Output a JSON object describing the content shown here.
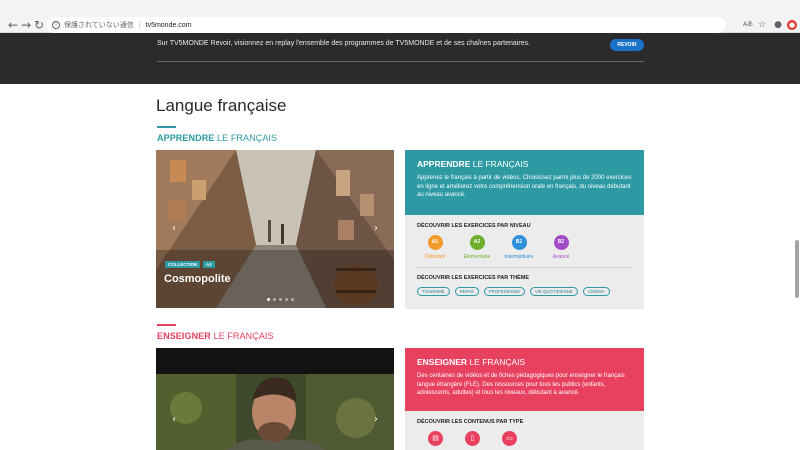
{
  "browser": {
    "back": "←",
    "forward": "→",
    "reload": "↻",
    "security_text": "保護されていない通信",
    "url": "tv5monde.com",
    "translate_icon": "Aあ",
    "star_icon": "☆",
    "profile_icon": "●",
    "extension_icon": "●"
  },
  "banner": {
    "text": "Sur TV5MONDE Revoir, visionnez en replay l'ensemble des programmes de TV5MONDE et de ses chaînes partenaires.",
    "button_label": "REVOIR"
  },
  "page": {
    "title": "Langue française"
  },
  "apprendre": {
    "label_bold": "APPRENDRE",
    "label_rest": " LE FRANÇAIS",
    "accent": "#2d9aa3",
    "carousel": {
      "tag_collection": "COLLECTION",
      "tag_level": "A2",
      "title": "Cosmopolite",
      "prev": "‹",
      "next": "›"
    },
    "panel": {
      "title_bold": "APPRENDRE",
      "title_rest": " LE FRANÇAIS",
      "text": "Apprenez le français à partir de vidéos. Choisissez parmi plus de 2000 exercices en ligne et améliorez votre compréhension orale en français, du niveau débutant au niveau avancé.",
      "levels_heading": "DÉCOUVRIR LES EXERCICES PAR NIVEAU",
      "levels": [
        {
          "code": "A1",
          "label": "Débutant",
          "color": "#f39a2b"
        },
        {
          "code": "A2",
          "label": "Élémentaire",
          "color": "#6fae2d"
        },
        {
          "code": "B1",
          "label": "Intermédiaire",
          "color": "#2f8fd8"
        },
        {
          "code": "B2",
          "label": "Avancé",
          "color": "#a44bc8"
        }
      ],
      "themes_heading": "DÉCOUVRIR LES EXERCICES PAR THÈME",
      "themes": [
        "TOURISME",
        "REPAS",
        "PROFESSIONS",
        "VIE QUOTIDIENNE",
        "CINÉMA"
      ]
    }
  },
  "enseigner": {
    "label_bold": "ENSEIGNER",
    "label_rest": " LE FRANÇAIS",
    "accent": "#e8405f",
    "carousel": {
      "prev": "‹",
      "next": "›"
    },
    "panel": {
      "title_bold": "ENSEIGNER",
      "title_rest": " LE FRANÇAIS",
      "text": "Des centaines de vidéos et de fiches pédagogiques pour enseigner le français langue étrangère (FLE). Des ressources pour tous les publics (enfants, adolescents, adultes) et tous les niveaux, débutant à avancé.",
      "types_heading": "DÉCOUVRIR LES CONTENUS PAR TYPE",
      "types": [
        {
          "icon": "document-icon",
          "glyph": "▤"
        },
        {
          "icon": "phone-icon",
          "glyph": "▯"
        },
        {
          "icon": "folder-icon",
          "glyph": "▭"
        }
      ]
    }
  }
}
